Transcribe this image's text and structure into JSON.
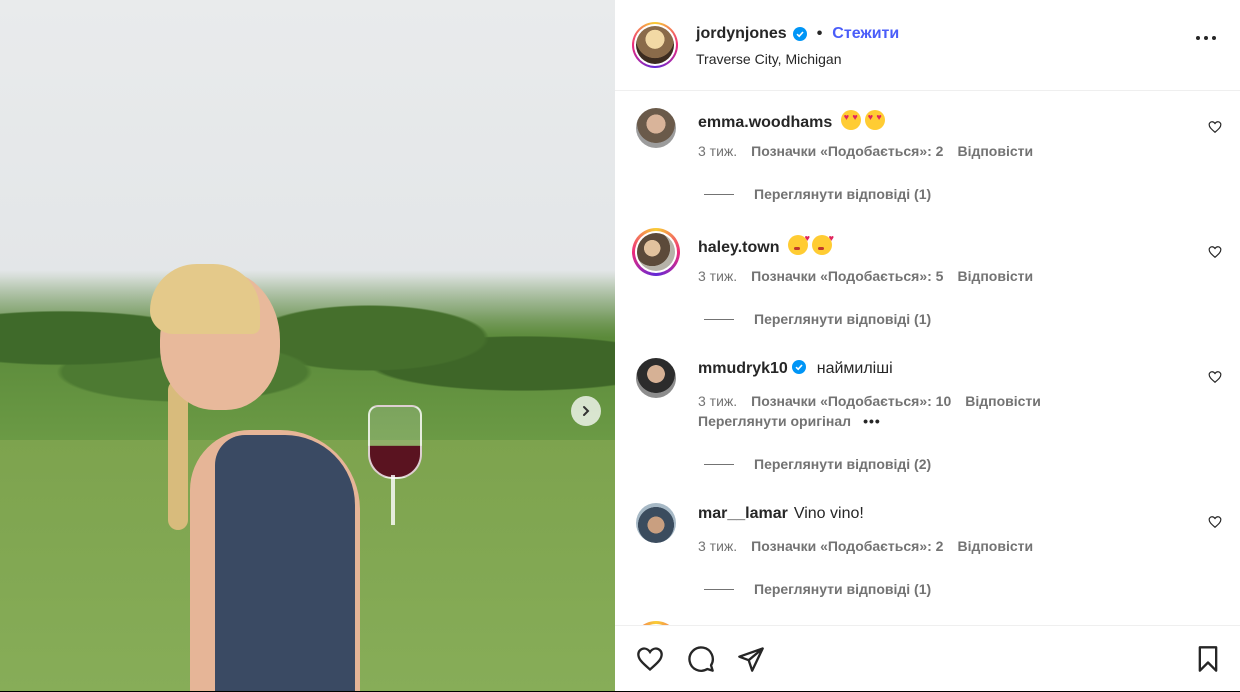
{
  "post": {
    "username": "jordynjones",
    "verified": true,
    "follow_label": "Стежити",
    "separator": "•",
    "location": "Traverse City, Michigan"
  },
  "comments": [
    {
      "username": "emma.woodhams",
      "text": "",
      "emoji": [
        "heart-eyes-emoji",
        "heart-eyes-emoji"
      ],
      "time": "3 тиж.",
      "likes": "Позначки «Подобається»: 2",
      "reply": "Відповісти",
      "view_replies": "Переглянути відповіді (1)"
    },
    {
      "username": "haley.town",
      "text": "",
      "emoji": [
        "kiss-emoji",
        "kiss-emoji"
      ],
      "time": "3 тиж.",
      "likes": "Позначки «Подобається»: 5",
      "reply": "Відповісти",
      "view_replies": "Переглянути відповіді (1)"
    },
    {
      "username": "mmudryk10",
      "verified": true,
      "text": "наймиліші",
      "time": "3 тиж.",
      "likes": "Позначки «Подобається»: 10",
      "reply": "Відповісти",
      "view_original": "Переглянути оригінал",
      "more": "•••",
      "view_replies": "Переглянути відповіді (2)"
    },
    {
      "username": "mar__lamar",
      "text": "Vino vino!",
      "time": "3 тиж.",
      "likes": "Позначки «Подобається»: 2",
      "reply": "Відповісти",
      "view_replies": "Переглянути відповіді (1)"
    }
  ],
  "colors": {
    "follow": "#4a5df9",
    "meta": "#737373",
    "text": "#262626"
  },
  "icons": [
    "like-icon",
    "comment-icon",
    "share-icon",
    "save-icon",
    "more-options-icon",
    "next-arrow-icon",
    "verified-icon"
  ]
}
